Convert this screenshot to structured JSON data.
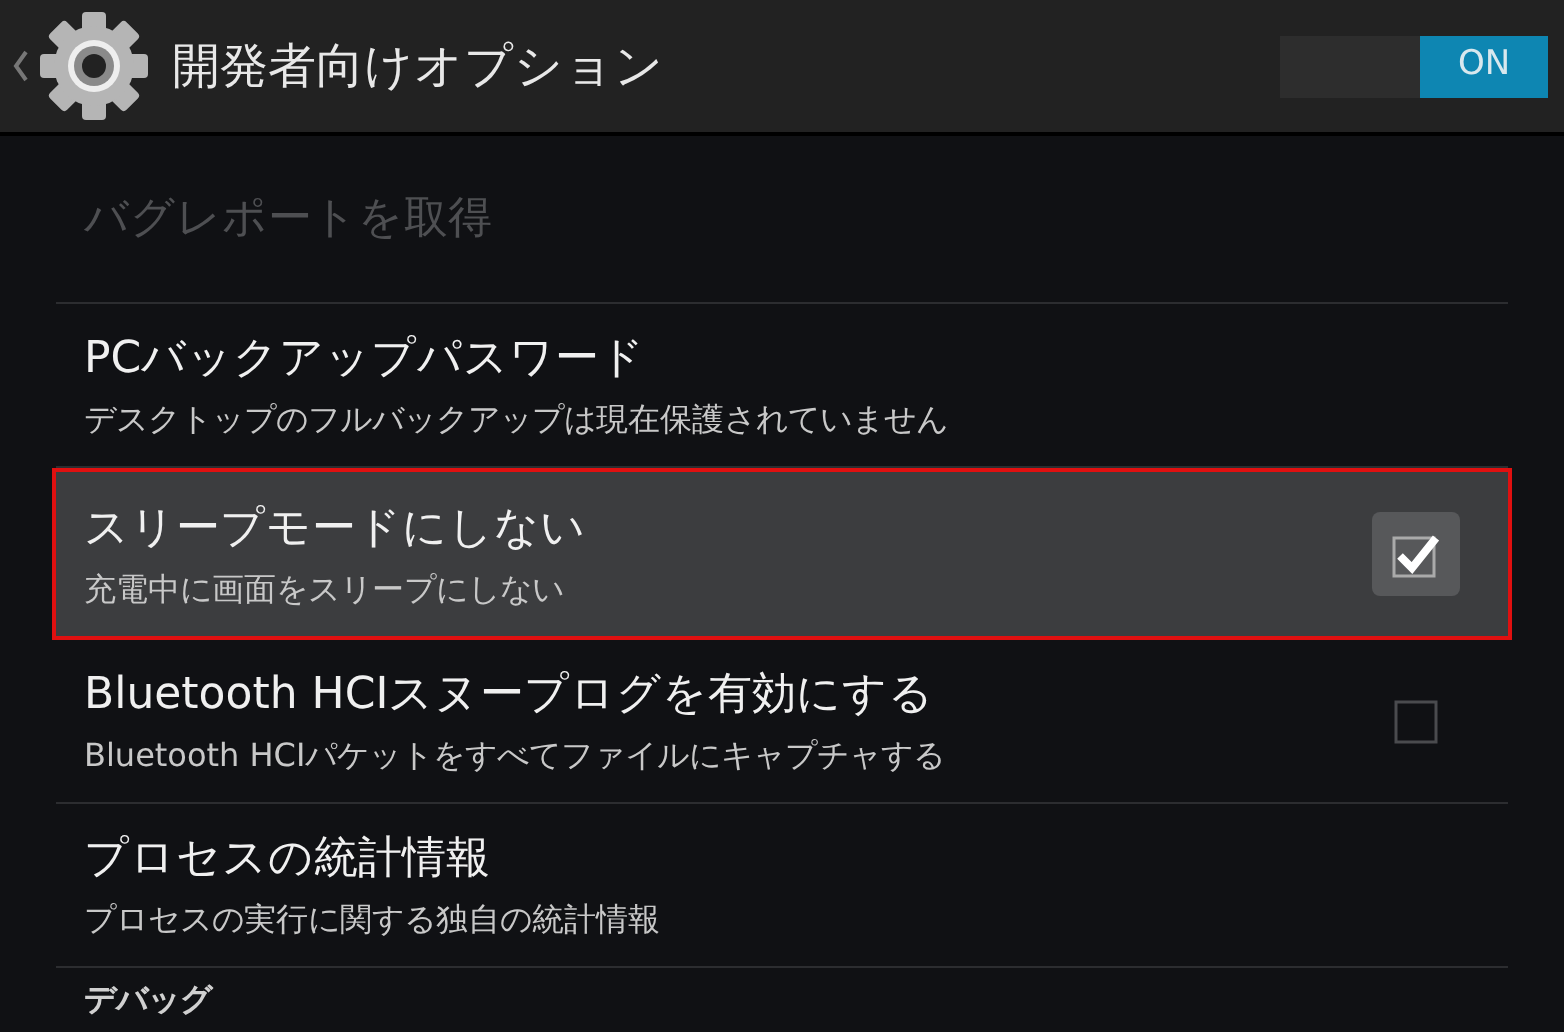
{
  "action_bar": {
    "title": "開発者向けオプション",
    "toggle": {
      "label": "ON",
      "on": true
    }
  },
  "items": [
    {
      "kind": "plain",
      "title": "バグレポートを取得",
      "disabled": true,
      "highlighted": false
    },
    {
      "kind": "plain",
      "title": "PCバックアップパスワード",
      "summary": "デスクトップのフルバックアップは現在保護されていません",
      "disabled": false,
      "highlighted": false
    },
    {
      "kind": "checkbox",
      "title": "スリープモードにしない",
      "summary": "充電中に画面をスリープにしない",
      "checked": true,
      "disabled": false,
      "highlighted": true
    },
    {
      "kind": "checkbox",
      "title": "Bluetooth HCIスヌープログを有効にする",
      "summary": "Bluetooth HCIパケットをすべてファイルにキャプチャする",
      "checked": false,
      "disabled": false,
      "highlighted": false
    },
    {
      "kind": "plain",
      "title": "プロセスの統計情報",
      "summary": "プロセスの実行に関する独自の統計情報",
      "disabled": false,
      "highlighted": false
    }
  ],
  "section_header": "デバッグ"
}
